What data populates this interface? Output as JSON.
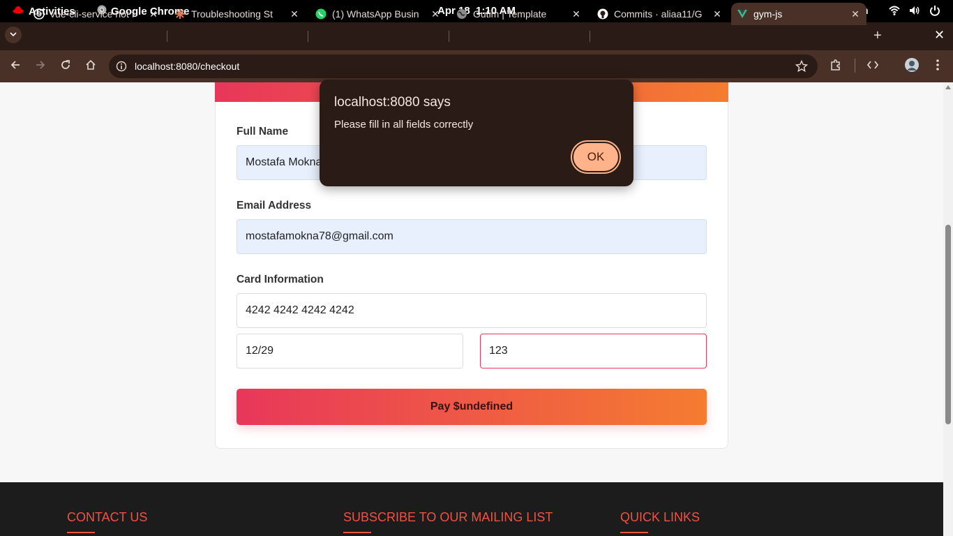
{
  "system_bar": {
    "activities": "Activities",
    "app_name": "Google Chrome",
    "clock": "Apr 18  1:10 AM",
    "language": "en"
  },
  "tabs": [
    {
      "title": "vue-cli-service not f",
      "icon": "chatgpt-icon"
    },
    {
      "title": "Troubleshooting St",
      "icon": "claude-icon"
    },
    {
      "title": "(1) WhatsApp Busin",
      "icon": "whatsapp-icon"
    },
    {
      "title": "Gutim | Template",
      "icon": "globe-icon"
    },
    {
      "title": "Commits · aliaa11/G",
      "icon": "github-icon"
    },
    {
      "title": "gym-js",
      "icon": "vue-icon",
      "active": true
    }
  ],
  "address_bar": {
    "url": "localhost:8080/checkout"
  },
  "form": {
    "full_name_label": "Full Name",
    "full_name_value": "Mostafa Mokna",
    "email_label": "Email Address",
    "email_value": "mostafamokna78@gmail.com",
    "card_label": "Card Information",
    "card_number": "4242 4242 4242 4242",
    "expiry": "12/29",
    "cvc": "123",
    "pay_button": "Pay $undefined"
  },
  "footer": {
    "contact": "CONTACT US",
    "subscribe": "SUBSCRIBE TO OUR MAILING LIST",
    "quick_links": "QUICK LINKS"
  },
  "dialog": {
    "title": "localhost:8080 says",
    "message": "Please fill in all fields correctly",
    "ok": "OK"
  },
  "colors": {
    "brand_gradient_start": "#e8375a",
    "brand_gradient_end": "#f57c30",
    "footer_heading": "#f0533f",
    "dialog_bg": "#2b1b16",
    "ok_button": "#ffb38a"
  }
}
